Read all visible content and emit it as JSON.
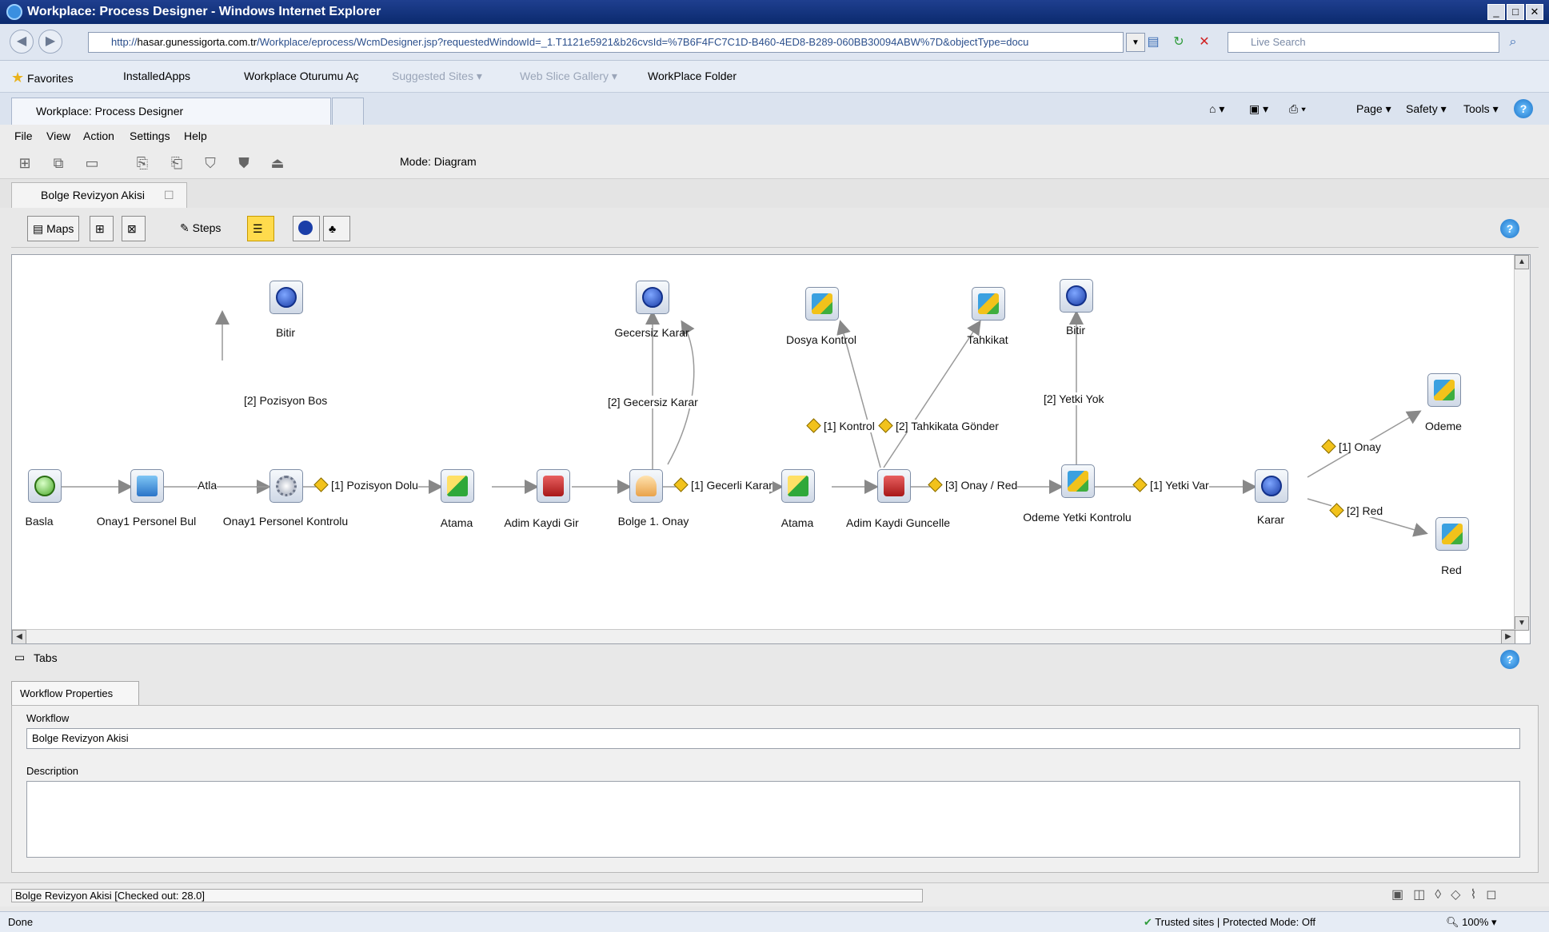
{
  "window": {
    "title": "Workplace: Process Designer - Windows Internet Explorer"
  },
  "browser": {
    "address_prefix": "http://",
    "address_host": "hasar.gunessigorta.com.tr",
    "address_rest": "/Workplace/eprocess/WcmDesigner.jsp?requestedWindowId=_1.T1121e5921&b26cvsId=%7B6F4FC7C1D-B460-4ED8-B289-060BB30094ABW%7D&objectType=docu",
    "search_placeholder": "Live Search",
    "favorites_label": "Favorites",
    "favorites": [
      {
        "label": "InstalledApps",
        "dim": false
      },
      {
        "label": "Workplace Oturumu Aç",
        "dim": false
      },
      {
        "label": "Suggested Sites ▾",
        "dim": true
      },
      {
        "label": "Web Slice Gallery ▾",
        "dim": true
      },
      {
        "label": "WorkPlace Folder",
        "dim": false
      }
    ],
    "tab_title": "Workplace: Process Designer",
    "commands": [
      "Page ▾",
      "Safety ▾",
      "Tools ▾"
    ]
  },
  "app": {
    "menus": [
      "File",
      "View",
      "Action",
      "Settings",
      "Help"
    ],
    "mode_label": "Mode: Diagram",
    "doc_tab": "Bolge Revizyon Akisi",
    "palette": {
      "maps_label": "Maps",
      "steps_label": "Steps"
    }
  },
  "diagram": {
    "nodes": [
      {
        "id": "n-basla",
        "label": "Basla",
        "icon": "start-circle-icon"
      },
      {
        "id": "n-onay1bul",
        "label": "Onay1 Personel Bul",
        "icon": "plug-task-icon"
      },
      {
        "id": "n-onay1kontrol",
        "label": "Onay1 Personel Kontrolu",
        "icon": "gear-icon"
      },
      {
        "id": "n-atama1",
        "label": "Atama",
        "icon": "assign-icon"
      },
      {
        "id": "n-adimgir",
        "label": "Adim Kaydi Gir",
        "icon": "database-icon"
      },
      {
        "id": "n-bolge1onay",
        "label": "Bolge 1. Onay",
        "icon": "user-icon"
      },
      {
        "id": "n-atama2",
        "label": "Atama",
        "icon": "assign-icon"
      },
      {
        "id": "n-adimguncelle",
        "label": "Adim Kaydi Guncelle",
        "icon": "database-icon"
      },
      {
        "id": "n-odemeyetki",
        "label": "Odeme Yetki Kontrolu",
        "icon": "subprocess-icon"
      },
      {
        "id": "n-karar",
        "label": "Karar",
        "icon": "end-circle-icon"
      },
      {
        "id": "n-bitir1",
        "label": "Bitir",
        "icon": "end-circle-icon"
      },
      {
        "id": "n-gecersizkarar",
        "label": "Gecersiz Karar",
        "icon": "end-circle-icon"
      },
      {
        "id": "n-dosyakontrol",
        "label": "Dosya Kontrol",
        "icon": "subprocess-icon"
      },
      {
        "id": "n-tahkikat",
        "label": "Tahkikat",
        "icon": "subprocess-icon"
      },
      {
        "id": "n-bitir2",
        "label": "Bitir",
        "icon": "end-circle-icon"
      },
      {
        "id": "n-odeme",
        "label": "Odeme",
        "icon": "subprocess-icon"
      },
      {
        "id": "n-red",
        "label": "Red",
        "icon": "subprocess-icon"
      }
    ],
    "edges": {
      "atla": "Atla",
      "pozisyon_dolu": "[1] Pozisyon Dolu",
      "pozisyon_bos": "[2] Pozisyon Bos",
      "gecerli_karar": "[1] Gecerli Karar",
      "gecersiz_karar": "[2] Gecersiz Karar",
      "kontrol": "[1] Kontrol",
      "tahkikata_gonder": "[2] Tahkikata Gönder",
      "onay_red": "[3] Onay / Red",
      "yetki_yok": "[2] Yetki Yok",
      "yetki_var": "[1] Yetki Var",
      "onay": "[1] Onay",
      "red": "[2] Red"
    }
  },
  "properties": {
    "tabs_label": "Tabs",
    "tab_title": "Workflow Properties",
    "workflow_label": "Workflow",
    "workflow_value": "Bolge Revizyon Akisi",
    "description_label": "Description",
    "description_value": ""
  },
  "status": {
    "app_status": "Bolge Revizyon Akisi [Checked out: 28.0]",
    "ie_done": "Done",
    "zone": "Trusted sites | Protected Mode: Off",
    "zoom": "100%"
  }
}
